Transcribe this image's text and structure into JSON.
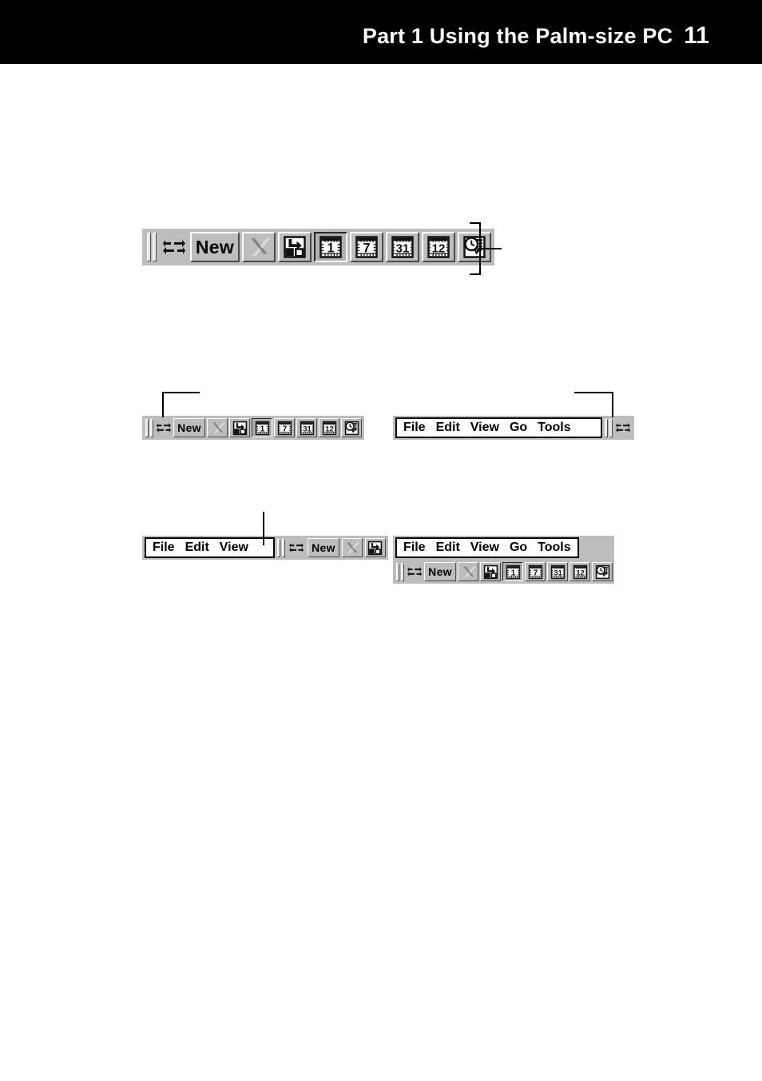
{
  "header": {
    "title": "Part 1  Using the Palm-size PC",
    "page_number": "11",
    "background": "#000000",
    "text_color": "#ffffff"
  },
  "theme": {
    "chrome": "#bdbdbd",
    "bevel_light": "#ffffff",
    "bevel_dark": "#4a4a4a",
    "ink": "#000000",
    "paper": "#ffffff",
    "disabled": "#8a8a8a"
  },
  "labels": {
    "new": "New",
    "file": "File",
    "edit": "Edit",
    "view": "View",
    "go": "Go",
    "tools": "Tools",
    "day": "1",
    "week": "7",
    "month": "31",
    "year": "12"
  },
  "icons": {
    "gripper": "gripper-handle",
    "arrows": "switch-arrows-icon",
    "new": "new-button",
    "delete": "delete-x-icon",
    "goto": "goto-shortcut-icon",
    "day_view": "day-view-icon",
    "week_view": "week-view-icon",
    "month_view": "month-view-icon",
    "year_view": "year-view-icon",
    "agenda": "clock-agenda-icon"
  },
  "figures": [
    {
      "id": "figure-1",
      "caption": "",
      "toolbar": {
        "name": "calendar-command-bar",
        "items": [
          "gripper",
          "arrows",
          "New",
          "delete",
          "goto",
          "1",
          "7",
          "31",
          "12",
          "agenda"
        ],
        "pressed_item": "1"
      },
      "callout": {
        "type": "bracket-with-leader"
      }
    },
    {
      "id": "figure-2-left",
      "toolbar": {
        "name": "calendar-command-bar-compact",
        "items": [
          "gripper",
          "arrows",
          "New",
          "delete",
          "goto",
          "1",
          "7",
          "31",
          "12",
          "agenda"
        ],
        "pressed_item": "1"
      },
      "callout": {
        "type": "elbow-leader",
        "direction": "right"
      }
    },
    {
      "id": "figure-2-right",
      "menubar": {
        "name": "main-menu-bar",
        "items": [
          "File",
          "Edit",
          "View",
          "Go",
          "Tools"
        ]
      },
      "trailing": [
        "gripper",
        "arrows"
      ],
      "callout": {
        "type": "elbow-leader",
        "direction": "left"
      }
    },
    {
      "id": "figure-3-left",
      "menubar": {
        "name": "short-menu-bar",
        "items": [
          "File",
          "Edit",
          "View"
        ]
      },
      "trailing": [
        "gripper",
        "arrows",
        "New",
        "delete",
        "goto"
      ],
      "callout": {
        "type": "straight-leader"
      }
    },
    {
      "id": "figure-3-right",
      "menubar": {
        "name": "main-menu-bar",
        "items": [
          "File",
          "Edit",
          "View",
          "Go",
          "Tools"
        ]
      },
      "toolbar": {
        "name": "calendar-command-bar-compact",
        "items": [
          "gripper",
          "arrows",
          "New",
          "delete",
          "goto",
          "1",
          "7",
          "31",
          "12",
          "agenda"
        ],
        "pressed_item": "1"
      },
      "callout": null
    }
  ]
}
